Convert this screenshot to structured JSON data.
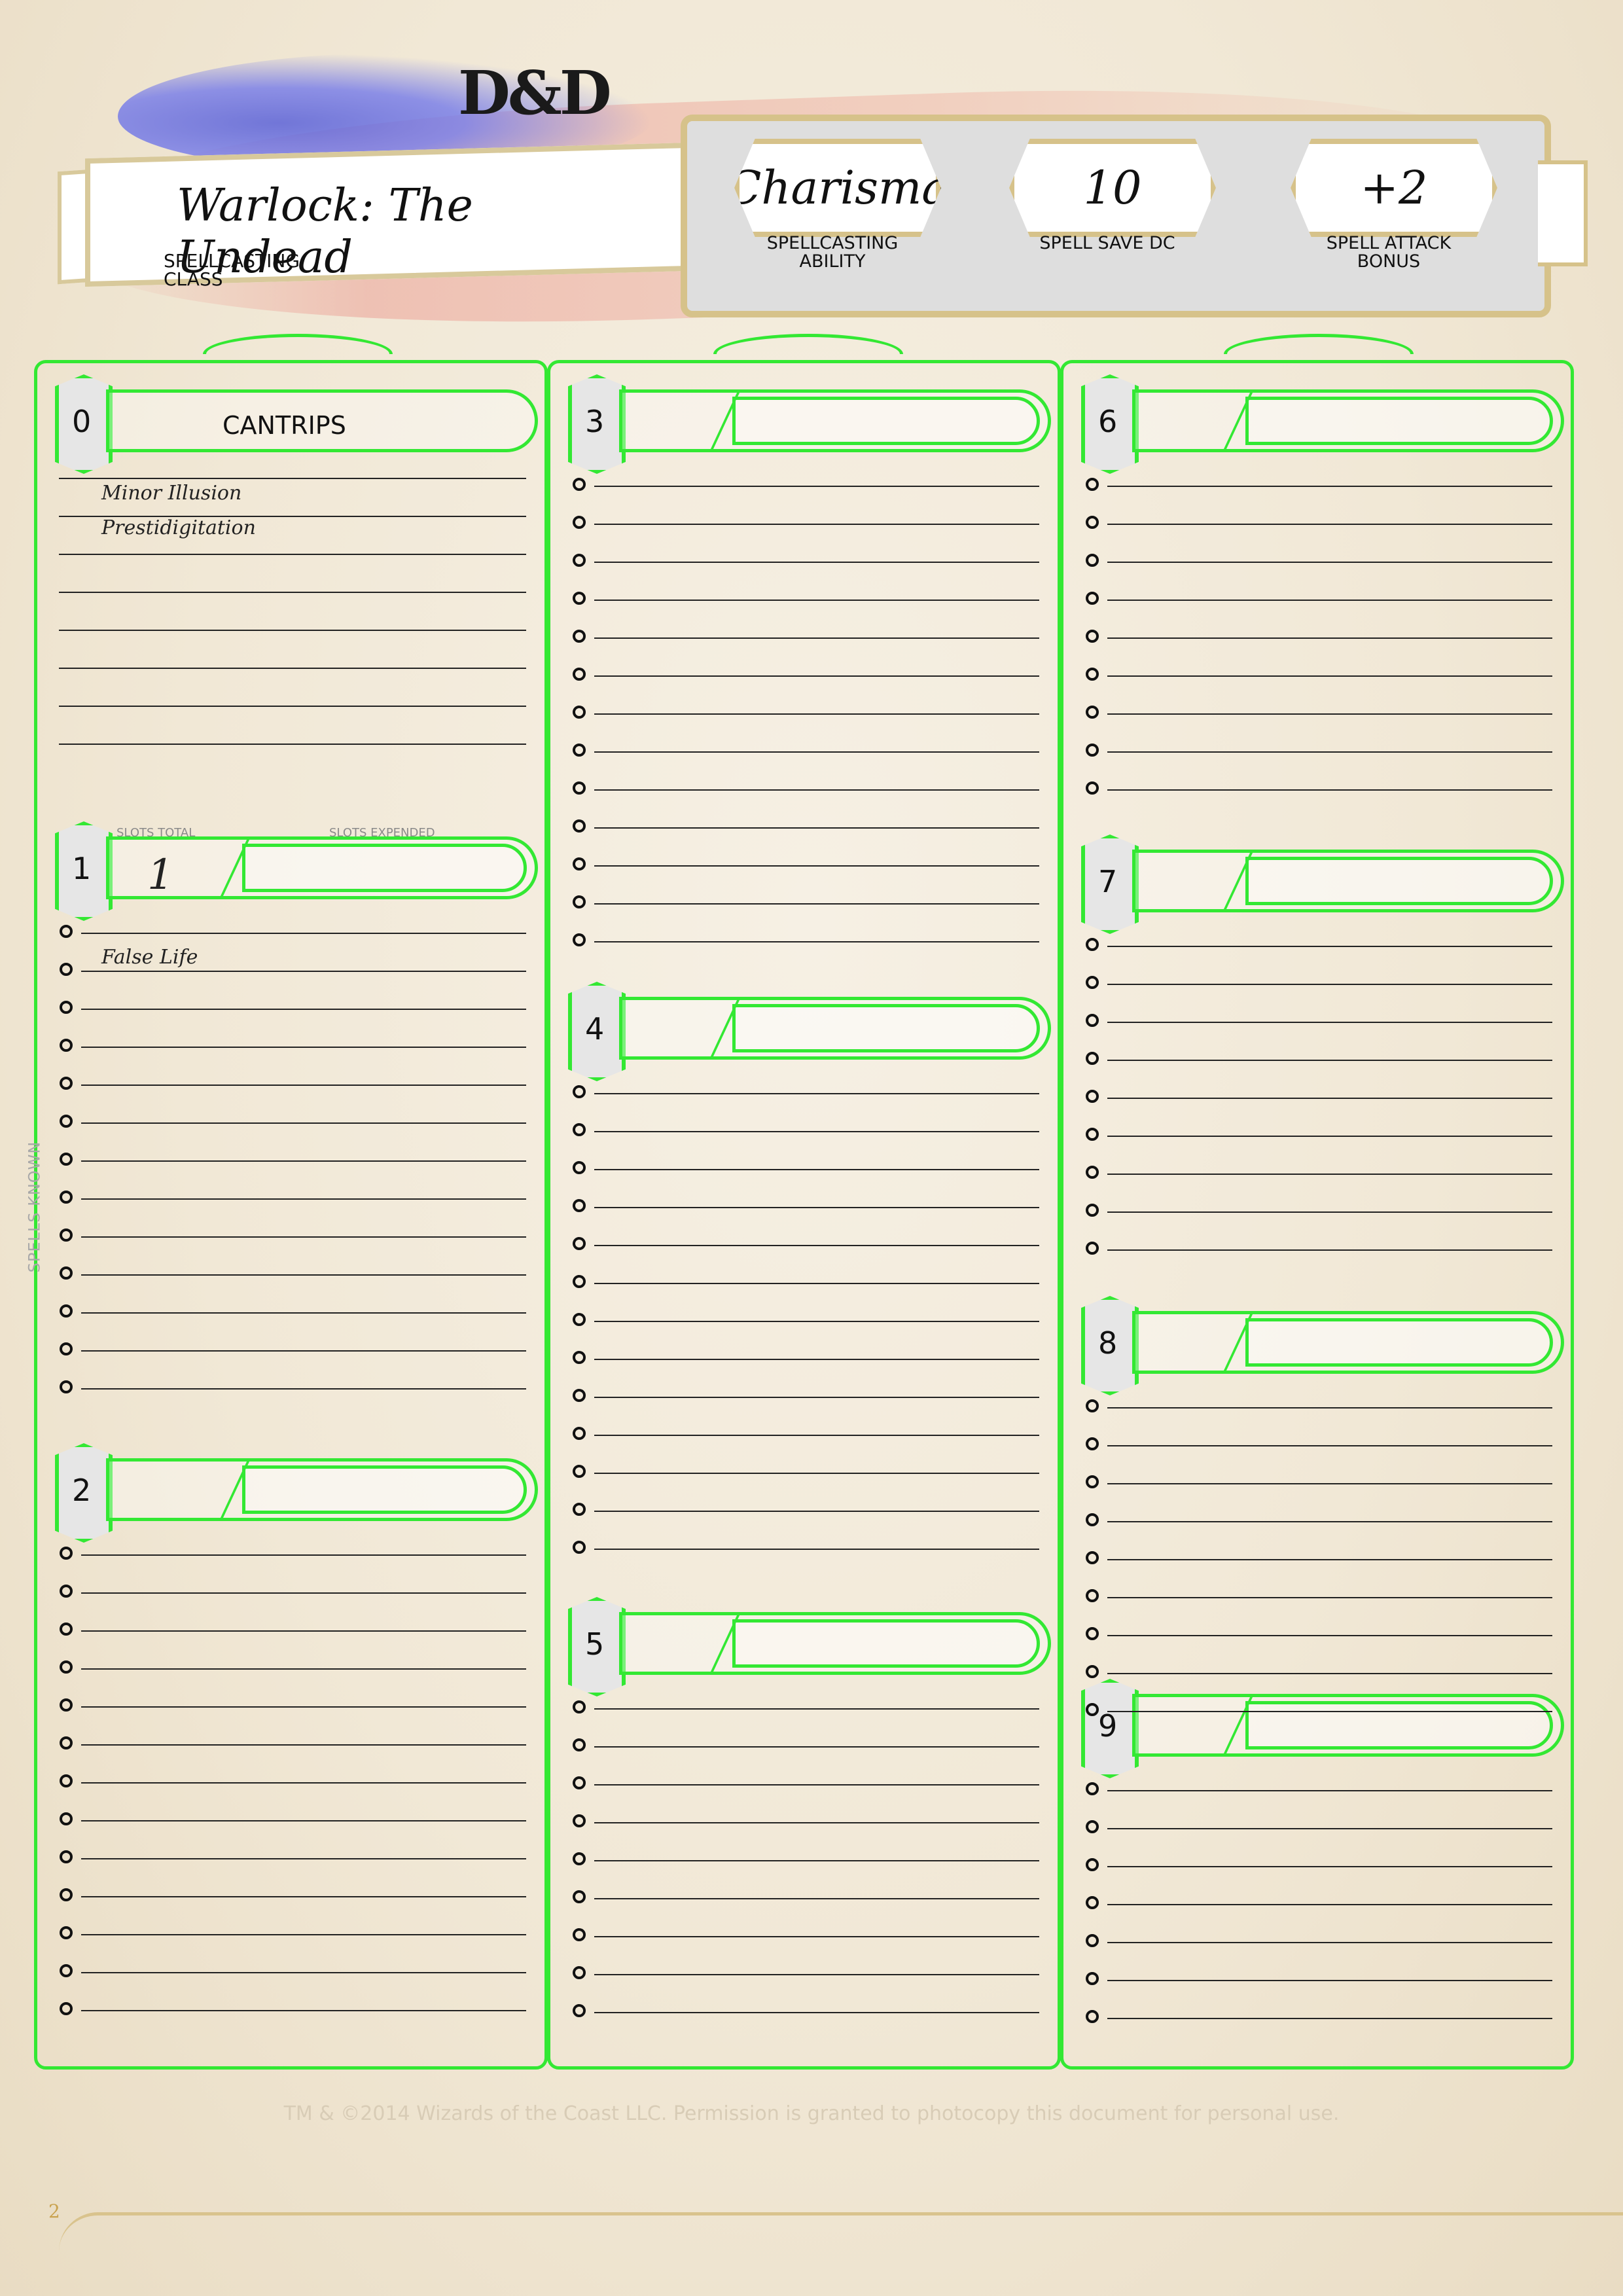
{
  "header": {
    "logo_text": "D&D",
    "class_value": "Warlock: The Undead",
    "class_label_1": "SPELLCASTING",
    "class_label_2": "CLASS",
    "stats": [
      {
        "value": "Charisma",
        "label_1": "SPELLCASTING",
        "label_2": "ABILITY"
      },
      {
        "value": "10",
        "label_1": "SPELL SAVE DC",
        "label_2": ""
      },
      {
        "value": "+2",
        "label_1": "SPELL ATTACK",
        "label_2": "BONUS"
      }
    ]
  },
  "levels": {
    "l0": {
      "num": "0",
      "title": "CANTRIPS"
    },
    "l1": {
      "num": "1",
      "slots_total": "1",
      "slots_total_label": "SLOTS TOTAL",
      "slots_expended_label": "SLOTS EXPENDED"
    },
    "l2": {
      "num": "2"
    },
    "l3": {
      "num": "3"
    },
    "l4": {
      "num": "4"
    },
    "l5": {
      "num": "5"
    },
    "l6": {
      "num": "6"
    },
    "l7": {
      "num": "7"
    },
    "l8": {
      "num": "8"
    },
    "l9": {
      "num": "9"
    }
  },
  "spells": {
    "cantrip_1": "Minor Illusion",
    "cantrip_2": "Prestidigitation",
    "level1_1": "False Life"
  },
  "side_label": "SPELLS KNOWN",
  "footer": "TM & ©2014 Wizards of the Coast LLC. Permission is granted to photocopy this document for personal use.",
  "page_number": "2"
}
